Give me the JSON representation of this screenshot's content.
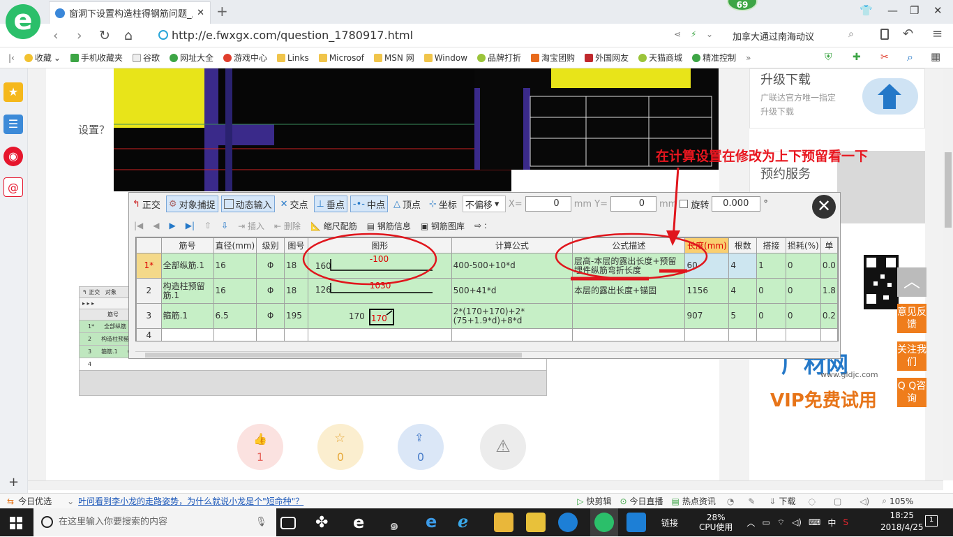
{
  "browser": {
    "tab_title": "窗洞下设置构造柱得钢筋问题_广",
    "badge": "69",
    "url": "http://e.fwxgx.com/question_1780917.html",
    "search_text": "加拿大通过南海动议",
    "bookmarks": [
      "收藏",
      "手机收藏夹",
      "谷歌",
      "网址大全",
      "游戏中心",
      "Links",
      "Microsof",
      "MSN 网",
      "Window",
      "品牌打折",
      "淘宝团购",
      "外国网友",
      "天猫商城",
      "精准控制"
    ]
  },
  "page": {
    "question_fragment": "设置？",
    "upgrade_title": "升级下载",
    "upgrade_sub": "广联达官方唯一指定升级下载",
    "booking_title": "预约服务",
    "annotation": "在计算设置在修改为上下预留看一下",
    "gld_logo": "广材网",
    "gld_url": "www.gldjc.com",
    "vip_text": "VIP免费试用",
    "side_buttons": [
      "意见反馈",
      "关注我们",
      "Q Q咨询"
    ],
    "vote_counts": [
      "1",
      "0",
      "0"
    ]
  },
  "dialog": {
    "toolbar1": {
      "ortho": "正交",
      "snap": "对象捕捉",
      "dyn_input": "动态输入",
      "intersect": "交点",
      "perp": "垂点",
      "mid": "中点",
      "vertex": "顶点",
      "coord": "坐标",
      "offset_mode": "不偏移",
      "x_label": "X=",
      "x_value": "0",
      "y_label": "mm Y=",
      "y_value": "0",
      "y_unit": "mm",
      "rotate": "旋转",
      "rotate_value": "0.000",
      "deg": "°"
    },
    "toolbar2": [
      "插入",
      "删除",
      "缩尺配筋",
      "钢筋信息",
      "钢筋图库"
    ],
    "columns": [
      "",
      "筋号",
      "直径(mm)",
      "级别",
      "图号",
      "图形",
      "计算公式",
      "公式描述",
      "长度(mm)",
      "根数",
      "搭接",
      "损耗(%)",
      "单"
    ],
    "rows": [
      {
        "no": "1*",
        "name": "全部纵筋.1",
        "dia": "16",
        "grade": "Φ",
        "fig": "18",
        "shape_left": "160",
        "shape_top": "-100",
        "formula": "400-500+10*d",
        "desc": "层高-本层的露出长度+预留埋件纵筋弯折长度",
        "length": "60",
        "count": "4",
        "lap": "1",
        "loss": "0",
        "unit": "0.0"
      },
      {
        "no": "2",
        "name": "构造柱预留筋.1",
        "dia": "16",
        "grade": "Φ",
        "fig": "18",
        "shape_left": "126",
        "shape_top": "1030",
        "formula": "500+41*d",
        "desc": "本层的露出长度+锚固",
        "length": "1156",
        "count": "4",
        "lap": "0",
        "loss": "0",
        "unit": "1.8"
      },
      {
        "no": "3",
        "name": "箍筋.1",
        "dia": "6.5",
        "grade": "Φ",
        "fig": "195",
        "shape_left": "170",
        "shape_top": "170",
        "formula": "2*(170+170)+2*(75+1.9*d)+8*d",
        "desc": "",
        "length": "907",
        "count": "5",
        "lap": "0",
        "loss": "0",
        "unit": "0.2"
      },
      {
        "no": "4",
        "name": "",
        "dia": "",
        "grade": "",
        "fig": "",
        "shape_left": "",
        "shape_top": "",
        "formula": "",
        "desc": "",
        "length": "",
        "count": "",
        "lap": "",
        "loss": "",
        "unit": ""
      }
    ]
  },
  "statusbar": {
    "today": "今日优选",
    "news": "叶问看到李小龙的走路姿势，为什么就说小龙是个\"短命种\"？",
    "items": [
      "快剪辑",
      "今日直播",
      "热点资讯",
      "下载",
      "105%"
    ]
  },
  "taskbar": {
    "search_placeholder": "在这里输入你要搜索的内容",
    "link": "链接",
    "cpu": "28%",
    "cpu_label": "CPU使用",
    "ime": "中",
    "time": "18:25",
    "date": "2018/4/25",
    "notif": "1"
  }
}
